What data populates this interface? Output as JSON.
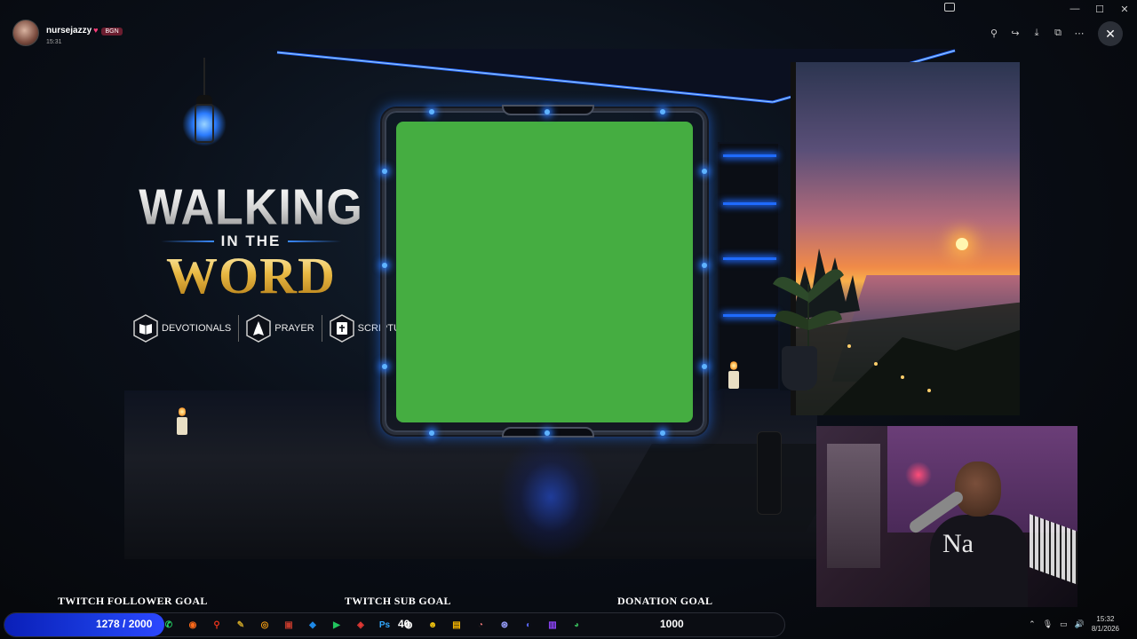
{
  "viewer": {
    "poster_name": "nursejazzy",
    "poster_badge": "BGN",
    "poster_time": "15:31"
  },
  "overlay": {
    "title_line1": "WALKING",
    "title_line2": "IN THE",
    "title_line3": "WORD",
    "categories": [
      {
        "label": "DEVOTIONALS",
        "icon": "book-icon"
      },
      {
        "label": "PRAYER",
        "icon": "praying-hands-icon"
      },
      {
        "label": "SCRIPTURE",
        "icon": "bible-icon"
      }
    ],
    "webcam_shirt_text": "Na"
  },
  "goals": {
    "follower": {
      "label": "TWITCH FOLLOWER GOAL",
      "value_text": "1278 / 2000",
      "progress": 0.639
    },
    "sub": {
      "label": "TWITCH SUB GOAL",
      "value_text": "40"
    },
    "donation": {
      "label": "DONATION GOAL",
      "value_text": "1000"
    }
  },
  "taskbar": {
    "apps": [
      {
        "name": "whatsapp-icon",
        "color": "#25d366",
        "glyph": "✆"
      },
      {
        "name": "firefox-icon",
        "color": "#ff6a1a",
        "glyph": "◉"
      },
      {
        "name": "search-icon",
        "color": "#e8341c",
        "glyph": "⚲"
      },
      {
        "name": "pen-icon",
        "color": "#c9a227",
        "glyph": "✎"
      },
      {
        "name": "obs-icon",
        "color": "#f39c12",
        "glyph": "◎"
      },
      {
        "name": "media-icon",
        "color": "#c0392b",
        "glyph": "▣"
      },
      {
        "name": "edge-icon",
        "color": "#1e88e5",
        "glyph": "◆"
      },
      {
        "name": "player-icon",
        "color": "#22c55e",
        "glyph": "▶"
      },
      {
        "name": "streamlabs-icon",
        "color": "#e53935",
        "glyph": "◈"
      },
      {
        "name": "photoshop-icon",
        "color": "#31a8ff",
        "glyph": "Ps"
      },
      {
        "name": "capture-icon",
        "color": "#ffffff",
        "glyph": "◍"
      },
      {
        "name": "ninja-icon",
        "color": "#f1c40f",
        "glyph": "☻"
      },
      {
        "name": "folder-icon",
        "color": "#f4b400",
        "glyph": "▤"
      },
      {
        "name": "clock-icon",
        "color": "#e57373",
        "glyph": "◔"
      },
      {
        "name": "fingerprint-icon",
        "color": "#9aa0ff",
        "glyph": "⊛"
      },
      {
        "name": "discord-icon",
        "color": "#5865f2",
        "glyph": "◐"
      },
      {
        "name": "twitch-icon",
        "color": "#9146ff",
        "glyph": "▥"
      },
      {
        "name": "chrome-icon",
        "color": "#34a853",
        "glyph": "◕"
      }
    ],
    "time": "15:32",
    "date": "8/1/2026"
  },
  "colors": {
    "green_screen": "#45ad41",
    "accent_blue": "#2a7bff",
    "gold": "#e9b944"
  }
}
